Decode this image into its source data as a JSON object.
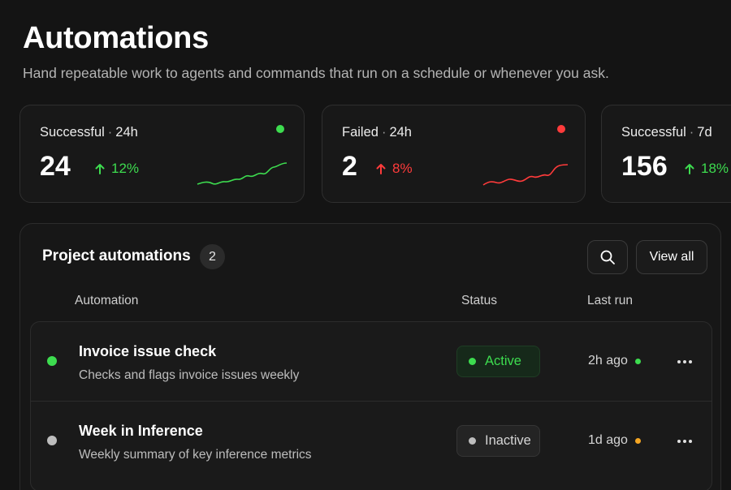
{
  "page": {
    "title": "Automations",
    "subtitle": "Hand repeatable work to agents and commands that run on a schedule or whenever you ask."
  },
  "stats": [
    {
      "label": "Successful",
      "period": "24h",
      "value": "24",
      "change": "12%",
      "direction": "up",
      "color": "#3ddc4f"
    },
    {
      "label": "Failed",
      "period": "24h",
      "value": "2",
      "change": "8%",
      "direction": "up",
      "color": "#ff3b3b"
    },
    {
      "label": "Successful",
      "period": "7d",
      "value": "156",
      "change": "18%",
      "direction": "up",
      "color": "#3ddc4f"
    }
  ],
  "panel": {
    "title": "Project automations",
    "count": "2",
    "search_icon": "search-icon",
    "view_all_label": "View all",
    "columns": {
      "automation": "Automation",
      "status": "Status",
      "last_run": "Last run"
    }
  },
  "automations": [
    {
      "name": "Invoice issue check",
      "description": "Checks and flags invoice issues weekly",
      "status": "Active",
      "last_run": "2h ago",
      "indicator_color": "#3ddc4f",
      "last_run_color": "#3ddc4f"
    },
    {
      "name": "Week in Inference",
      "description": "Weekly summary of key inference metrics",
      "status": "Inactive",
      "last_run": "1d ago",
      "indicator_color": "#bdbdbd",
      "last_run_color": "#f5a623"
    }
  ],
  "colors": {
    "success": "#3ddc4f",
    "failure": "#ff3b3b",
    "warning": "#f5a623",
    "inactive": "#bdbdbd"
  }
}
